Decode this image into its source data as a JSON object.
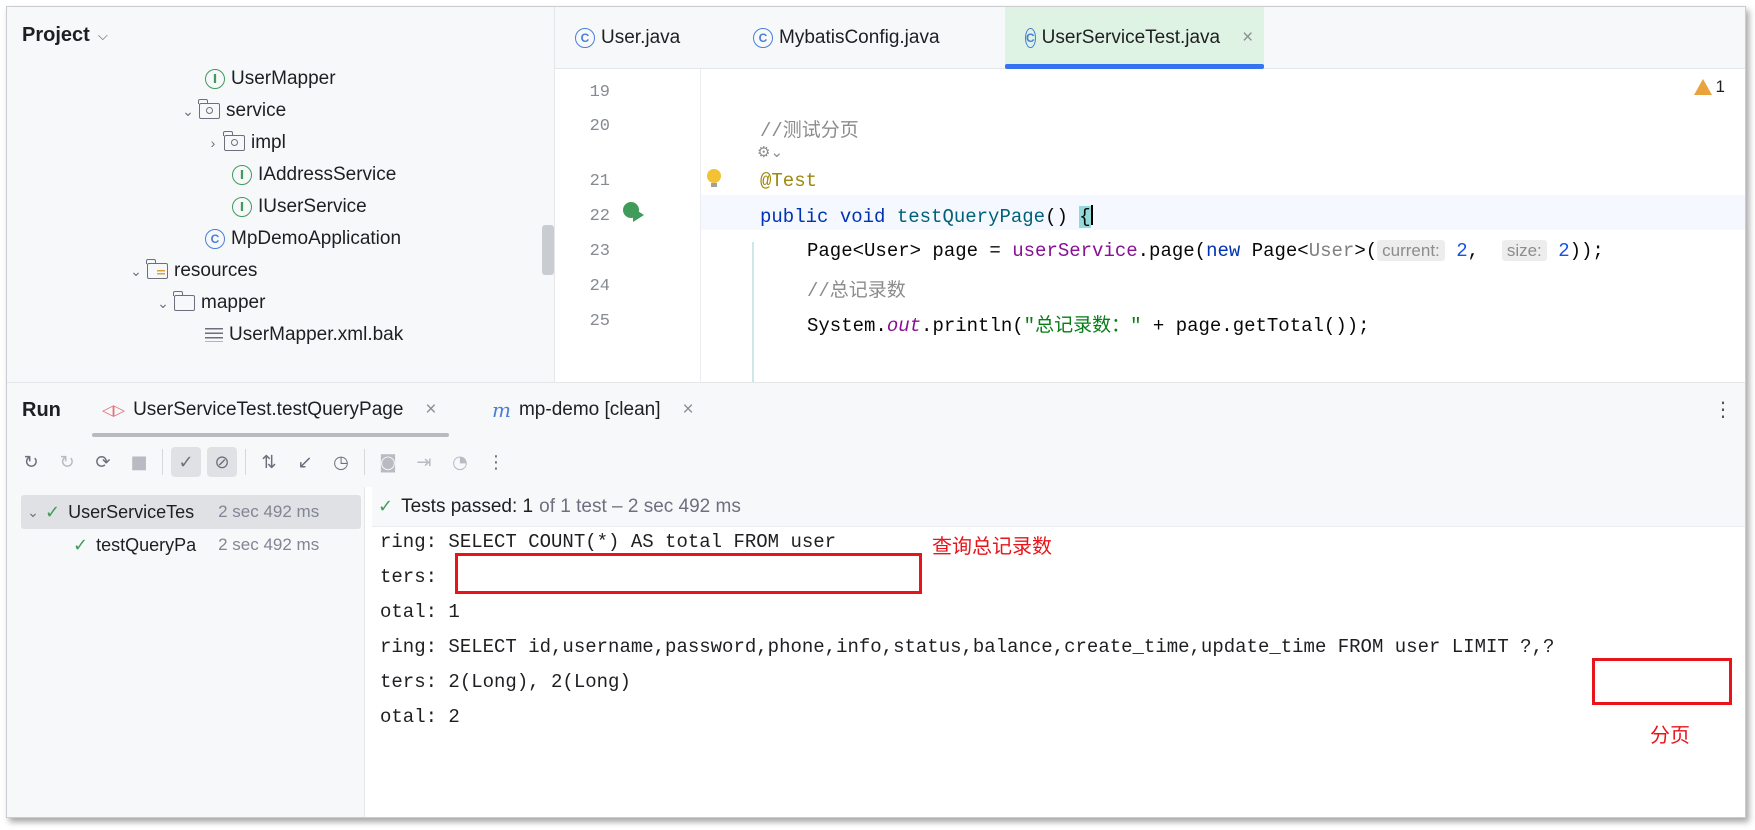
{
  "project": {
    "title": "Project",
    "tree": [
      {
        "label": "UserMapper",
        "icon": "interface-icon",
        "expander": ""
      },
      {
        "label": "service",
        "icon": "package-icon",
        "expander": "⌄"
      },
      {
        "label": "impl",
        "icon": "package-icon",
        "expander": "›"
      },
      {
        "label": "IAddressService",
        "icon": "interface-icon",
        "expander": ""
      },
      {
        "label": "IUserService",
        "icon": "interface-icon",
        "expander": ""
      },
      {
        "label": "MpDemoApplication",
        "icon": "class-icon",
        "expander": ""
      },
      {
        "label": "resources",
        "icon": "resources-folder-icon",
        "expander": "⌄"
      },
      {
        "label": "mapper",
        "icon": "folder-icon",
        "expander": "⌄"
      },
      {
        "label": "UserMapper.xml.bak",
        "icon": "file-icon",
        "expander": ""
      }
    ]
  },
  "editor": {
    "tabs": [
      {
        "label": "User.java",
        "active": false
      },
      {
        "label": "MybatisConfig.java",
        "active": false
      },
      {
        "label": "UserServiceTest.java",
        "active": true
      }
    ],
    "tab_close": "×",
    "warning_count": "1",
    "line_numbers": [
      "19",
      "20",
      "21",
      "22",
      "23",
      "24",
      "25"
    ],
    "code": {
      "l20_comment": "//测试分页",
      "l21_annotation": "@Test",
      "l22_kw1": "public",
      "l22_kw2": "void",
      "l22_method": "testQueryPage",
      "l22_rest": "() ",
      "l22_brace": "{",
      "l23_a": "Page<User> page = ",
      "l23_field": "userService",
      "l23_b": ".page(",
      "l23_new": "new",
      "l23_c": " Page<",
      "l23_gen": "User",
      "l23_d": ">(",
      "l23_hint1": "current:",
      "l23_num1": "2",
      "l23_comma": ",  ",
      "l23_hint2": "size:",
      "l23_num2": "2",
      "l23_end": "));",
      "l24_comment": "//总记录数",
      "l25_a": "System.",
      "l25_out": "out",
      "l25_b": ".println(",
      "l25_str": "\"总记录数：\"",
      "l25_c": " + page.getTotal());"
    }
  },
  "run": {
    "title": "Run",
    "tabs": [
      {
        "label": "UserServiceTest.testQueryPage",
        "active": true
      },
      {
        "label": "mp-demo [clean]",
        "active": false
      }
    ],
    "tab_close": "×",
    "tests": [
      {
        "name": "UserServiceTes",
        "duration": "2 sec 492 ms"
      },
      {
        "name": "testQueryPa",
        "duration": "2 sec 492 ms"
      }
    ],
    "status_main": "Tests passed: 1",
    "status_rest": "of 1 test – 2 sec 492 ms",
    "console_lines": [
      "ring: SELECT COUNT(*) AS total FROM user",
      "ters:",
      "otal: 1",
      "ring: SELECT id,username,password,phone,info,status,balance,create_time,update_time FROM user LIMIT ?,?",
      "ters: 2(Long), 2(Long)",
      "otal: 2"
    ],
    "annotations": {
      "count_label": "查询总记录数",
      "page_label": "分页"
    }
  },
  "colors": {
    "accent": "#3574f0",
    "success": "#3f9c5a",
    "annotation_red": "#e8141a",
    "active_tab_bg": "#dff3e4"
  }
}
